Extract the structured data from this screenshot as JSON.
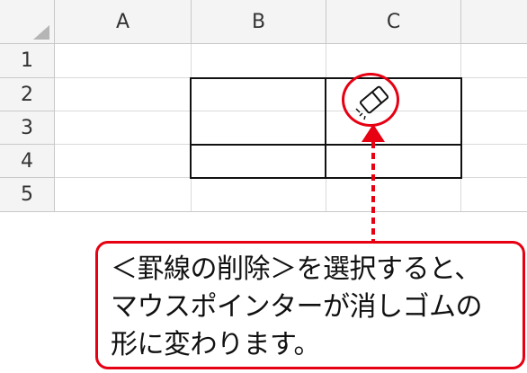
{
  "spreadsheet": {
    "column_headers": [
      "A",
      "B",
      "C"
    ],
    "row_headers": [
      "1",
      "2",
      "3",
      "4",
      "5"
    ]
  },
  "cursor": {
    "icon": "eraser-icon"
  },
  "callout": {
    "lines": [
      "＜罫線の削除＞を選択すると、",
      "マウスポインターが消しゴムの",
      "形に変わります。"
    ],
    "accent_color": "#e60012"
  }
}
